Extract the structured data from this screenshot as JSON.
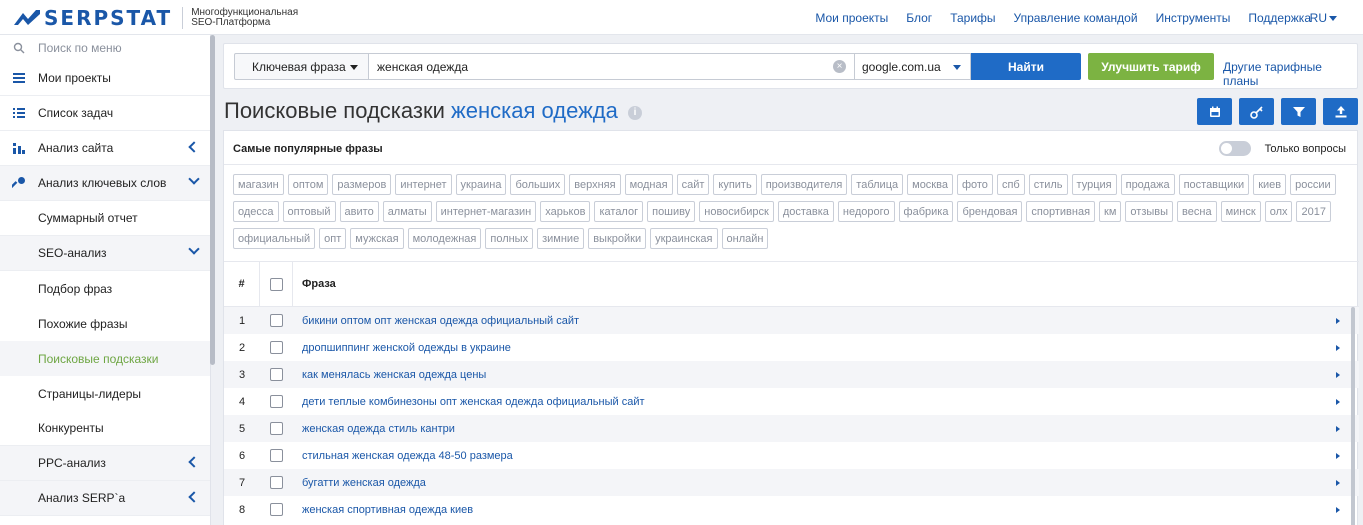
{
  "header": {
    "brand": "SERPSTAT",
    "brand_sub_1": "Многофункциональная",
    "brand_sub_2": "SEO-Платформа",
    "nav": [
      "Мои проекты",
      "Блог",
      "Тарифы",
      "Управление командой",
      "Инструменты",
      "Поддержка"
    ],
    "lang": "RU"
  },
  "sidebar": {
    "search_placeholder": "Поиск по меню",
    "items": [
      {
        "label": "Мои проекты",
        "icon": "menu-icon"
      },
      {
        "label": "Список задач",
        "icon": "list-icon"
      },
      {
        "label": "Анализ сайта",
        "icon": "chart-icon"
      },
      {
        "label": "Анализ ключевых слов",
        "icon": "key-icon"
      },
      {
        "label": "Суммарный отчет"
      },
      {
        "label": "SEO-анализ"
      },
      {
        "label": "Подбор фраз"
      },
      {
        "label": "Похожие фразы"
      },
      {
        "label": "Поисковые подсказки"
      },
      {
        "label": "Страницы-лидеры"
      },
      {
        "label": "Конкуренты"
      },
      {
        "label": "PPC-анализ"
      },
      {
        "label": "Анализ SERP`a"
      }
    ]
  },
  "searchbar": {
    "mode": "Ключевая фраза",
    "query": "женская одежда",
    "database": "google.com.ua",
    "find": "Найти",
    "upgrade": "Улучшить тариф",
    "other_plans": "Другие тарифные планы"
  },
  "page": {
    "title": "Поисковые подсказки",
    "keyword": "женская одежда"
  },
  "panel": {
    "title": "Самые популярные фразы",
    "toggle_label": "Только вопросы",
    "tags": [
      "магазин",
      "оптом",
      "размеров",
      "интернет",
      "украина",
      "больших",
      "верхняя",
      "модная",
      "сайт",
      "купить",
      "производителя",
      "таблица",
      "москва",
      "фото",
      "спб",
      "стиль",
      "турция",
      "продажа",
      "поставщики",
      "киев",
      "россии",
      "одесса",
      "оптовый",
      "авито",
      "алматы",
      "интернет-магазин",
      "харьков",
      "каталог",
      "пошиву",
      "новосибирск",
      "доставка",
      "недорого",
      "фабрика",
      "брендовая",
      "спортивная",
      "км",
      "отзывы",
      "весна",
      "минск",
      "олх",
      "2017",
      "официальный",
      "опт",
      "мужская",
      "молодежная",
      "полных",
      "зимние",
      "выкройки",
      "украинская",
      "онлайн"
    ]
  },
  "table": {
    "col_num": "#",
    "col_phrase": "Фраза",
    "rows": [
      {
        "n": "1",
        "phrase": "бикини оптом опт женская одежда официальный сайт"
      },
      {
        "n": "2",
        "phrase": "дропшиппинг женской одежды в украине"
      },
      {
        "n": "3",
        "phrase": "как менялась женская одежда цены"
      },
      {
        "n": "4",
        "phrase": "дети теплые комбинезоны опт женская одежда официальный сайт"
      },
      {
        "n": "5",
        "phrase": "женская одежда стиль кантри"
      },
      {
        "n": "6",
        "phrase": "стильная женская одежда 48-50 размера"
      },
      {
        "n": "7",
        "phrase": "бугатти женская одежда"
      },
      {
        "n": "8",
        "phrase": "женская спортивная одежда киев"
      }
    ]
  },
  "colors": {
    "brand": "#1a57a8",
    "primary_button": "#1f6bc6",
    "upgrade_button": "#7cb342",
    "active_menu": "#6ea643"
  }
}
